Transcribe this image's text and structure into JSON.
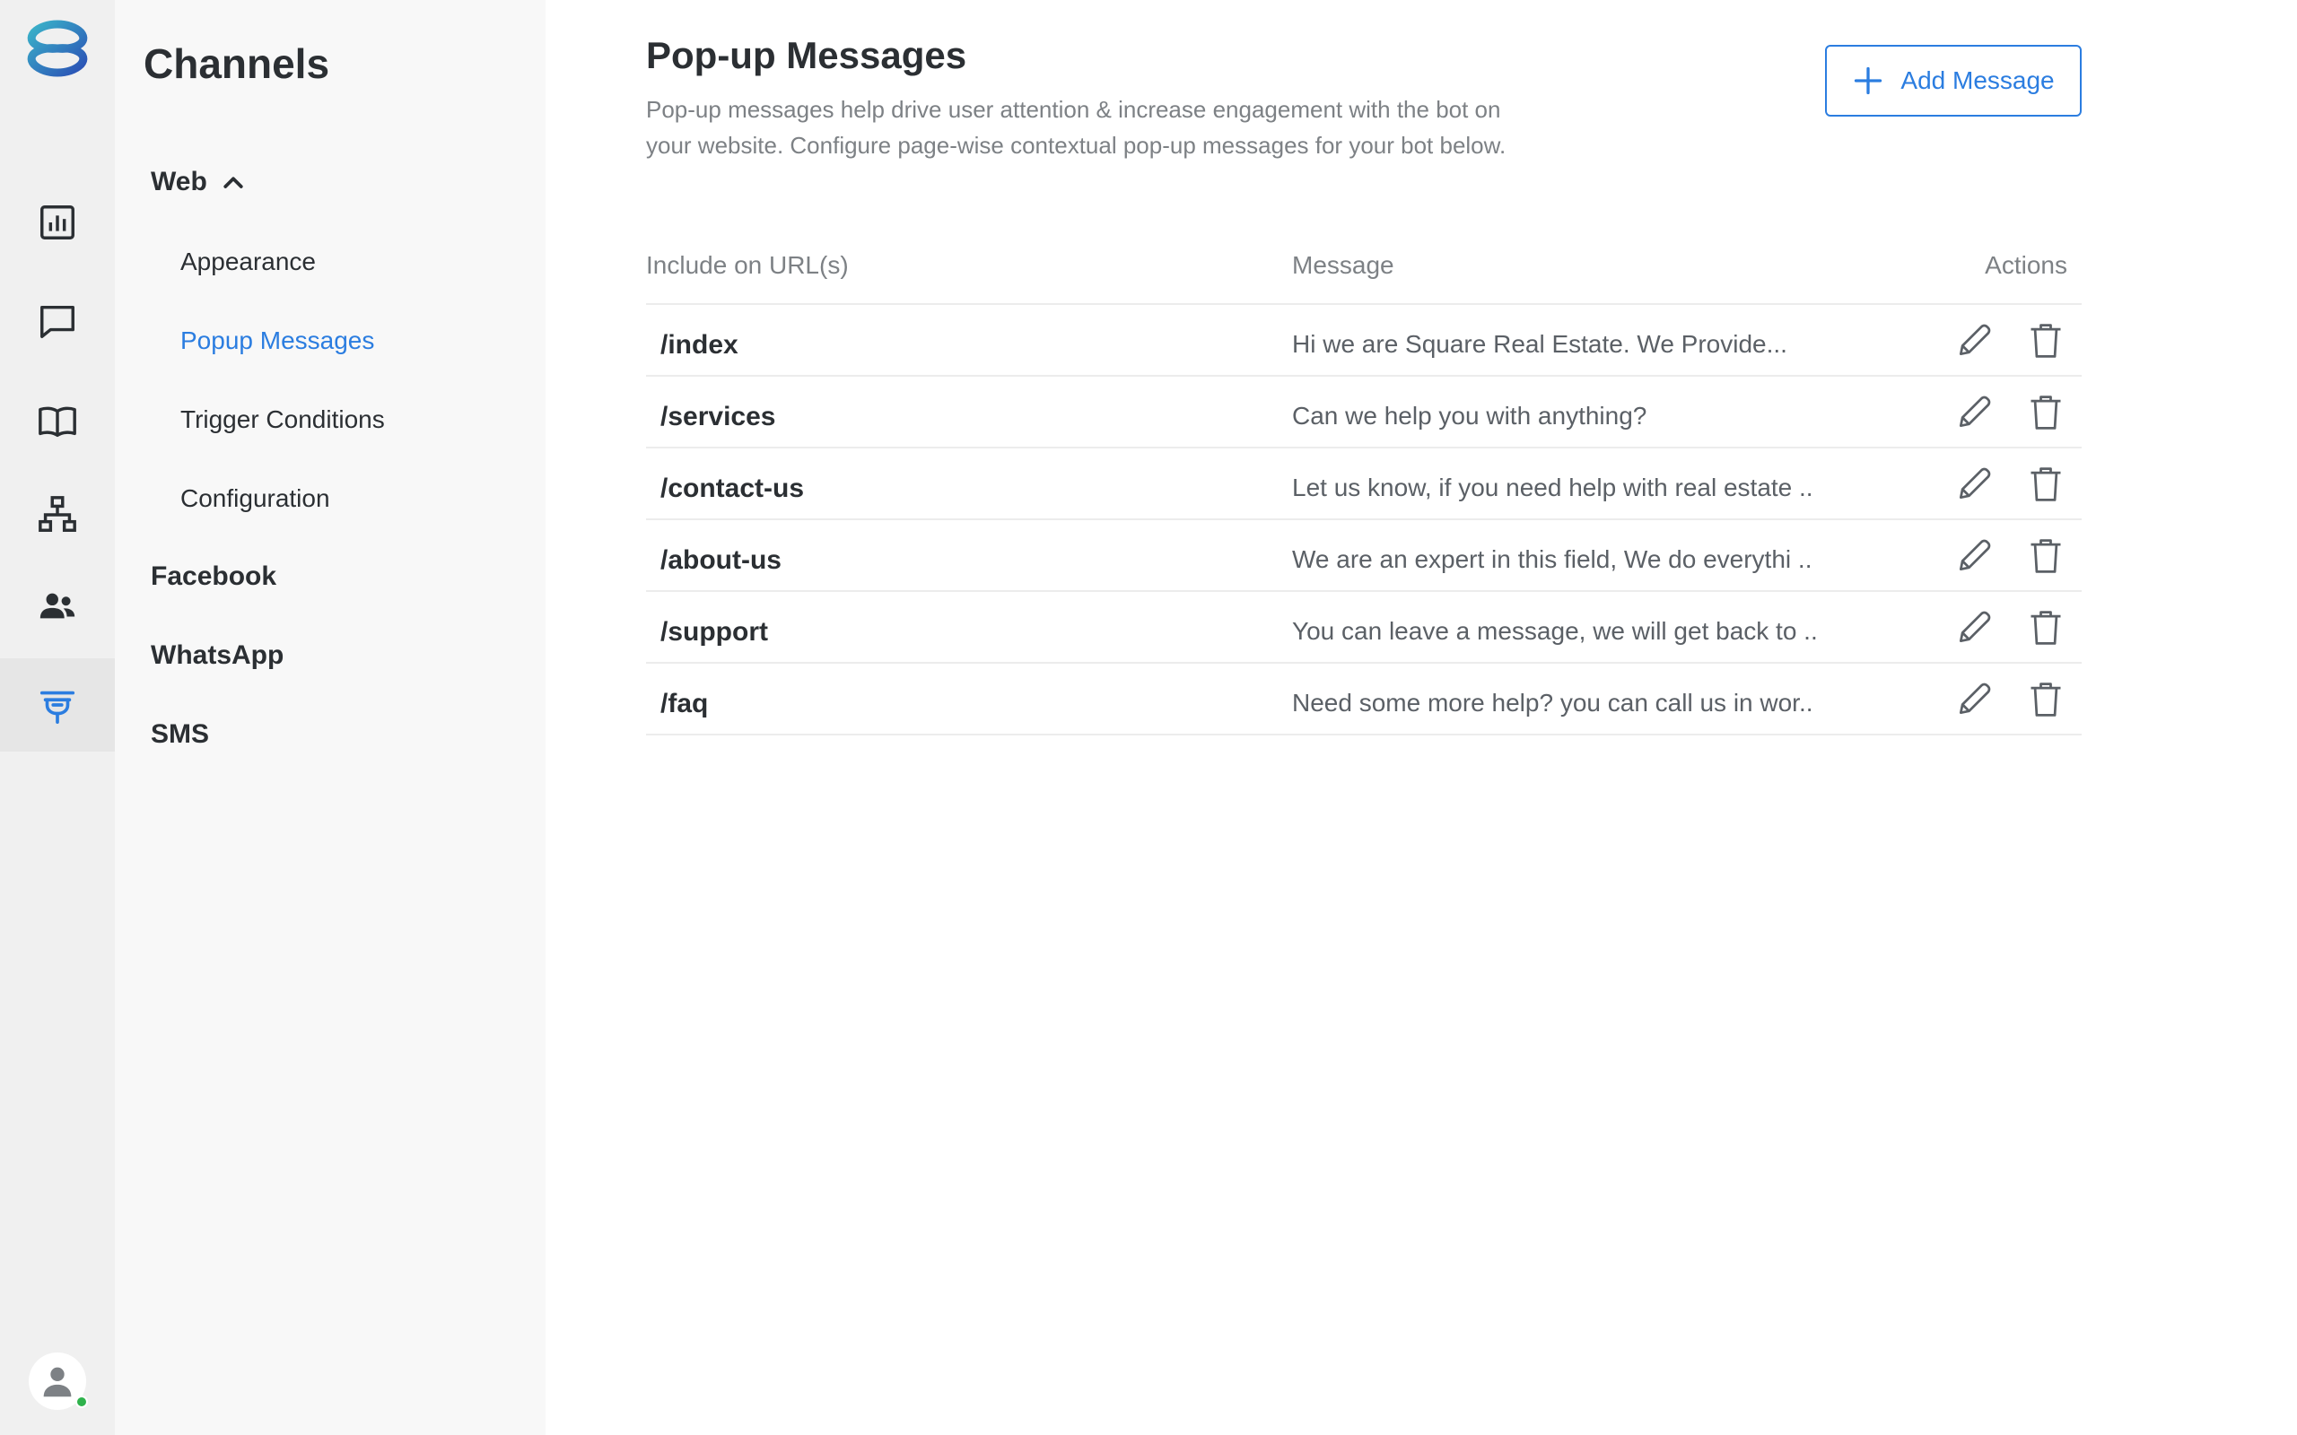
{
  "colors": {
    "accent": "#2b7de0",
    "rail_bg": "#f0f0f0",
    "sidebar_bg": "#f8f8f8",
    "text_dark": "#2b2f33",
    "text_muted": "#7d8185",
    "presence": "#2fb24c"
  },
  "rail": {
    "items": [
      {
        "name": "analytics",
        "icon": "bar-chart-icon",
        "active": false
      },
      {
        "name": "conversations",
        "icon": "chat-bubble-icon",
        "active": false
      },
      {
        "name": "knowledge-base",
        "icon": "open-book-icon",
        "active": false
      },
      {
        "name": "flows",
        "icon": "sitemap-icon",
        "active": false
      },
      {
        "name": "users",
        "icon": "users-icon",
        "active": false
      },
      {
        "name": "channels",
        "icon": "plug-icon",
        "active": true
      }
    ],
    "avatar_icon": "user-avatar-icon"
  },
  "sidebar": {
    "title": "Channels",
    "groups": [
      {
        "label": "Web",
        "expanded": true,
        "icon": "chevron-up-icon"
      },
      {
        "label": "Facebook"
      },
      {
        "label": "WhatsApp"
      },
      {
        "label": "SMS"
      }
    ],
    "web_items": [
      {
        "label": "Appearance",
        "active": false
      },
      {
        "label": "Popup Messages",
        "active": true
      },
      {
        "label": "Trigger Conditions",
        "active": false
      },
      {
        "label": "Configuration",
        "active": false
      }
    ]
  },
  "main": {
    "title": "Pop-up Messages",
    "description": "Pop-up messages help drive user attention & increase engagement with the bot on your website. Configure page-wise contextual pop-up messages for your bot below.",
    "add_button_label": "Add Message",
    "table": {
      "columns": [
        "Include on URL(s)",
        "Message",
        "Actions"
      ],
      "rows": [
        {
          "url": "/index",
          "message": "Hi we are Square Real Estate. We Provide..."
        },
        {
          "url": "/services",
          "message": "Can we help you with anything?"
        },
        {
          "url": "/contact-us",
          "message": "Let us know, if you need help with real estate .."
        },
        {
          "url": "/about-us",
          "message": "We are an expert in this field, We do everythi .."
        },
        {
          "url": "/support",
          "message": "You can leave a message, we will get back to .."
        },
        {
          "url": "/faq",
          "message": "Need some more help? you can call us in wor.."
        }
      ]
    }
  }
}
